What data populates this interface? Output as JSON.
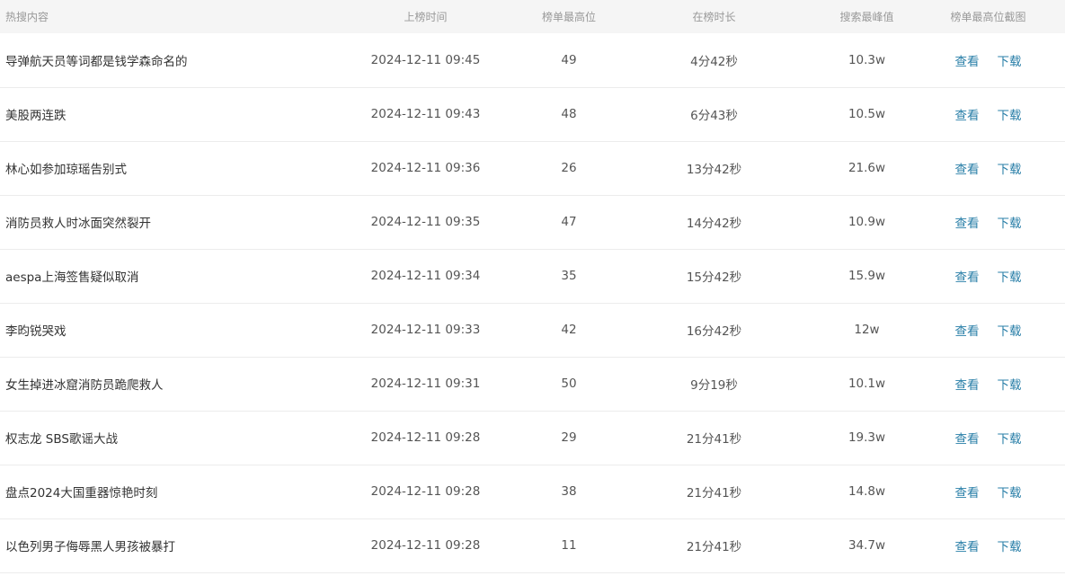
{
  "columns": {
    "topic": "热搜内容",
    "time": "上榜时间",
    "rank": "榜单最高位",
    "duration": "在榜时长",
    "peak": "搜索最峰值",
    "screenshot": "榜单最高位截图"
  },
  "actions": {
    "view": "查看",
    "download": "下载"
  },
  "colors": {
    "header_bg": "#f5f5f5",
    "link": "#2a7fa8",
    "divider": "#ececec"
  },
  "rows": [
    {
      "topic": "导弹航天员等词都是钱学森命名的",
      "time": "2024-12-11 09:45",
      "rank": "49",
      "duration": "4分42秒",
      "peak": "10.3w"
    },
    {
      "topic": "美股两连跌",
      "time": "2024-12-11 09:43",
      "rank": "48",
      "duration": "6分43秒",
      "peak": "10.5w"
    },
    {
      "topic": "林心如参加琼瑶告别式",
      "time": "2024-12-11 09:36",
      "rank": "26",
      "duration": "13分42秒",
      "peak": "21.6w"
    },
    {
      "topic": "消防员救人时冰面突然裂开",
      "time": "2024-12-11 09:35",
      "rank": "47",
      "duration": "14分42秒",
      "peak": "10.9w"
    },
    {
      "topic": "aespa上海签售疑似取消",
      "time": "2024-12-11 09:34",
      "rank": "35",
      "duration": "15分42秒",
      "peak": "15.9w"
    },
    {
      "topic": "李昀锐哭戏",
      "time": "2024-12-11 09:33",
      "rank": "42",
      "duration": "16分42秒",
      "peak": "12w"
    },
    {
      "topic": "女生掉进冰窟消防员跪爬救人",
      "time": "2024-12-11 09:31",
      "rank": "50",
      "duration": "9分19秒",
      "peak": "10.1w"
    },
    {
      "topic": "权志龙 SBS歌谣大战",
      "time": "2024-12-11 09:28",
      "rank": "29",
      "duration": "21分41秒",
      "peak": "19.3w"
    },
    {
      "topic": "盘点2024大国重器惊艳时刻",
      "time": "2024-12-11 09:28",
      "rank": "38",
      "duration": "21分41秒",
      "peak": "14.8w"
    },
    {
      "topic": "以色列男子侮辱黑人男孩被暴打",
      "time": "2024-12-11 09:28",
      "rank": "11",
      "duration": "21分41秒",
      "peak": "34.7w"
    }
  ]
}
